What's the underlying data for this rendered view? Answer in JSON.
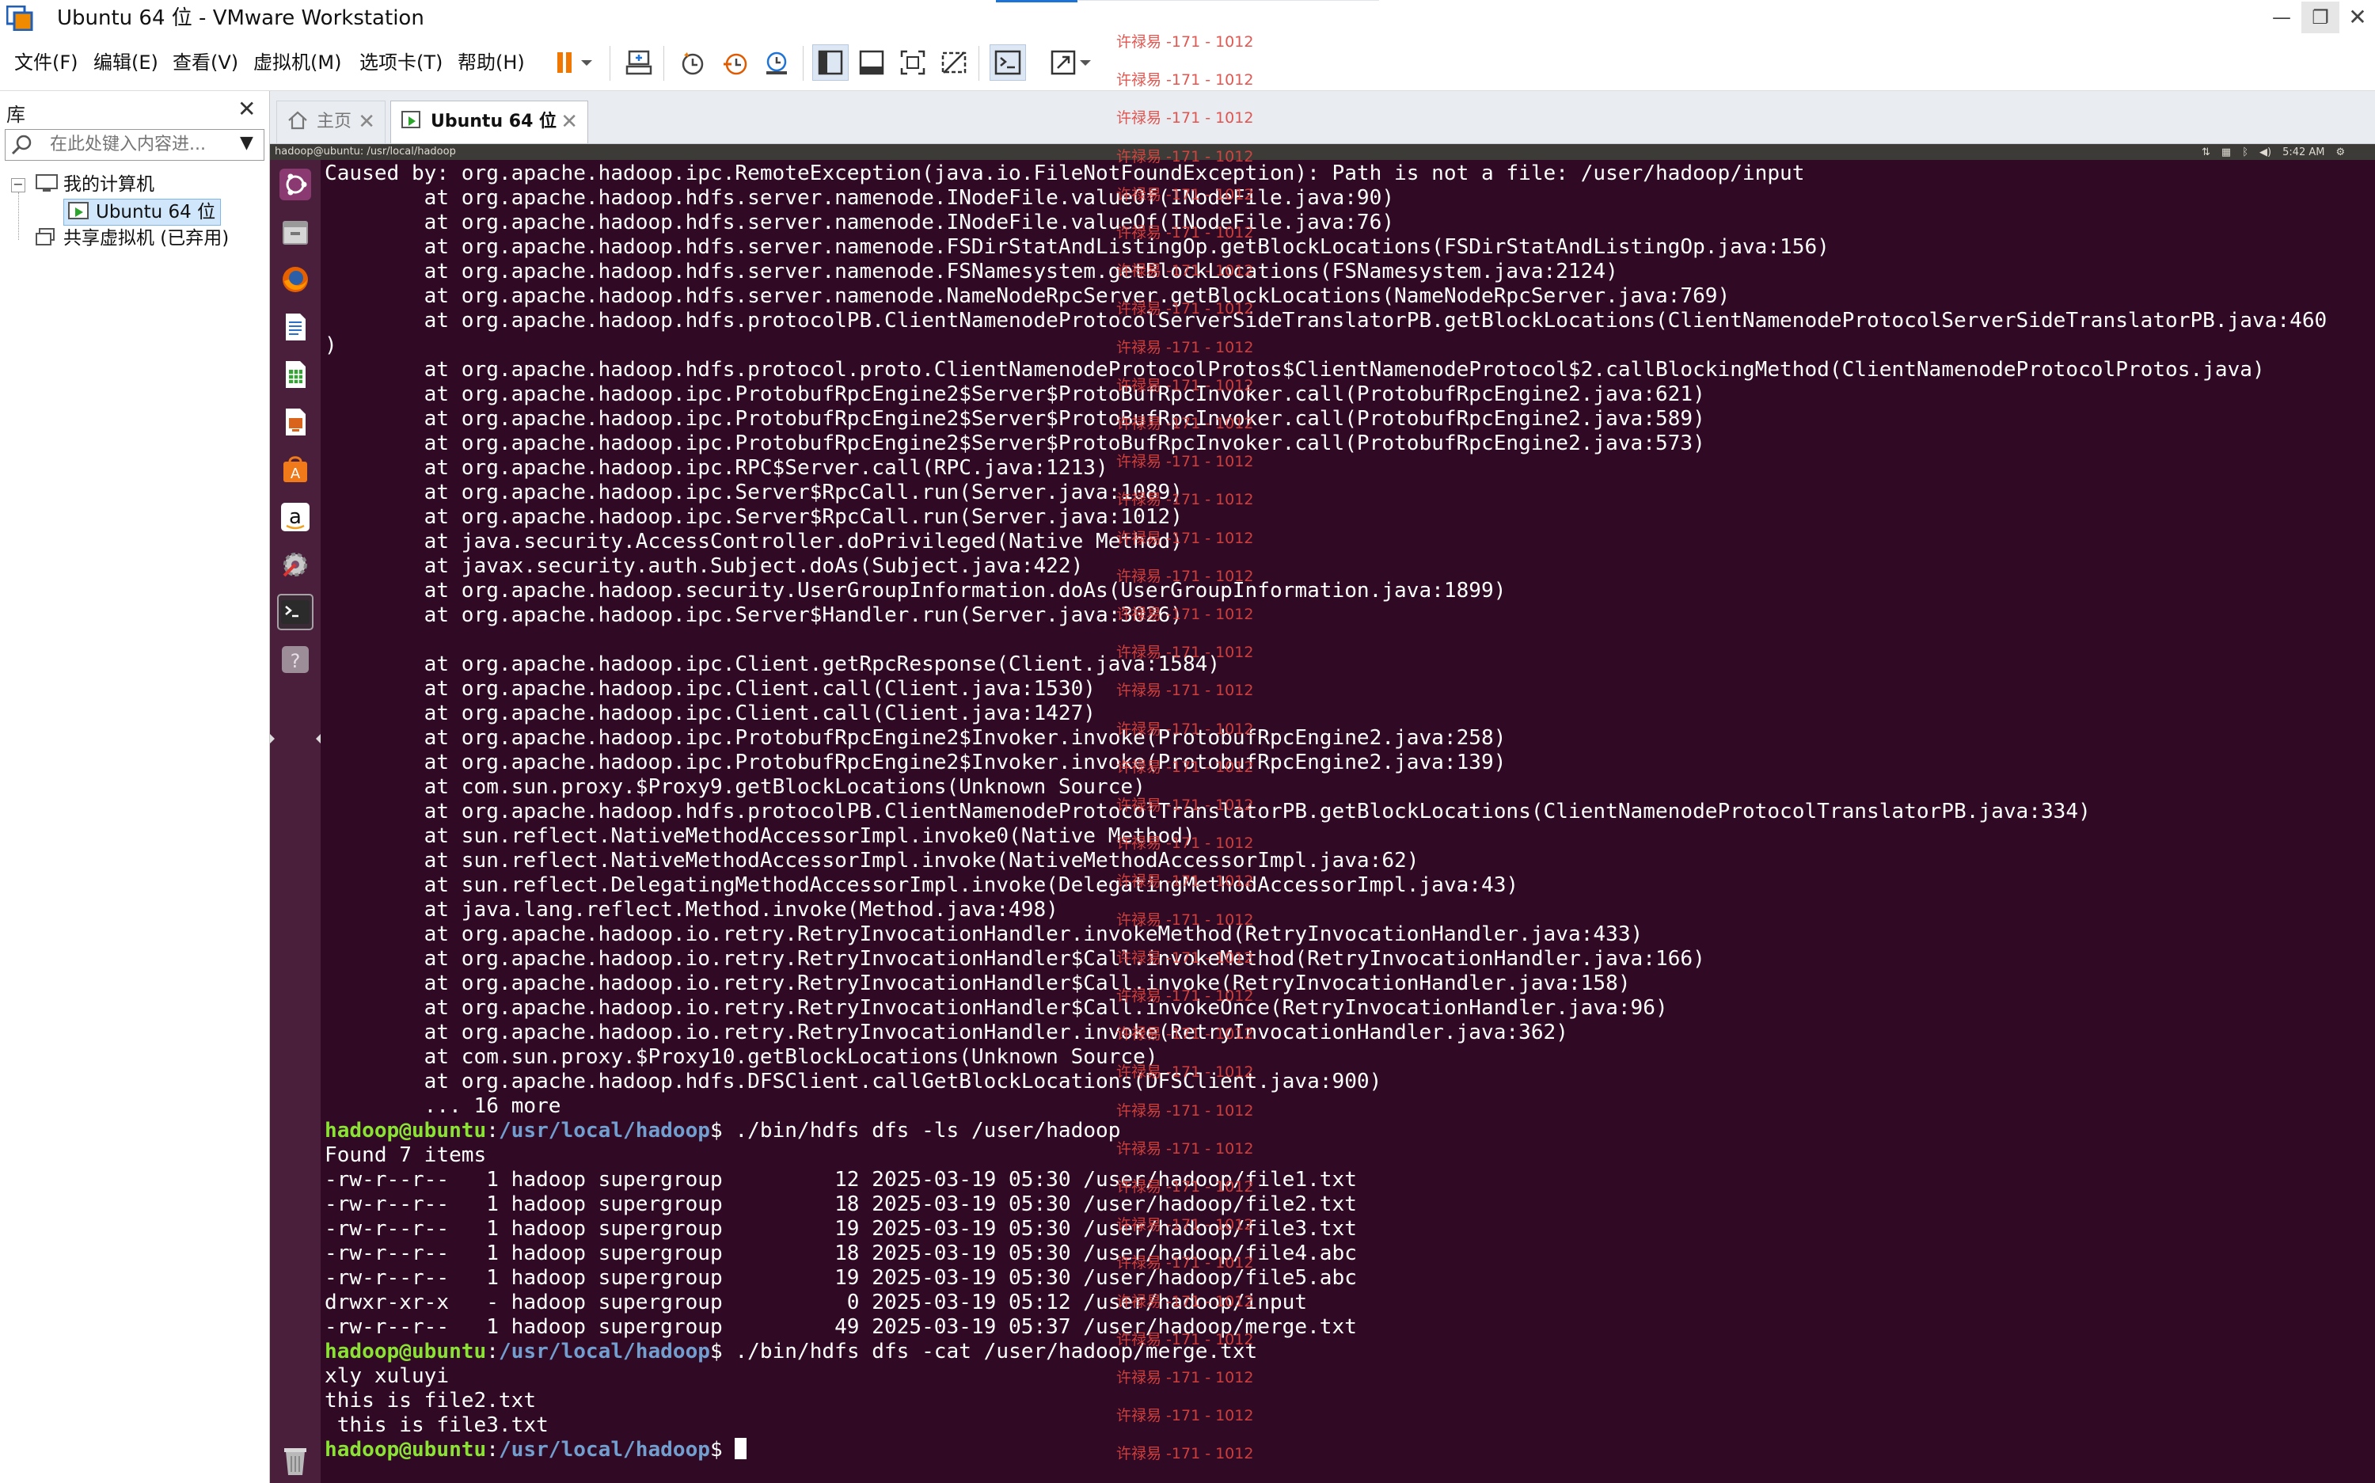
{
  "window": {
    "title": "Ubuntu 64 位 - VMware Workstation",
    "minimize": "—",
    "maximize": "❐",
    "close": "✕"
  },
  "menu": [
    "文件(F)",
    "编辑(E)",
    "查看(V)",
    "虚拟机(M)",
    "选项卡(T)",
    "帮助(H)"
  ],
  "library": {
    "title": "库",
    "close": "✕",
    "search_placeholder": "在此处键入内容进...",
    "tree": {
      "my_computer": "我的计算机",
      "ubuntu": "Ubuntu 64 位",
      "shared": "共享虚拟机 (已弃用)"
    }
  },
  "tabs": {
    "home": "主页",
    "ubuntu": "Ubuntu 64 位",
    "close": "✕"
  },
  "vm": {
    "panel_title": "hadoop@ubuntu: /usr/local/hadoop",
    "clock": "5:42 AM"
  },
  "terminal": {
    "block1": "Caused by: org.apache.hadoop.ipc.RemoteException(java.io.FileNotFoundException): Path is not a file: /user/hadoop/input\n\tat org.apache.hadoop.hdfs.server.namenode.INodeFile.valueOf(INodeFile.java:90)\n\tat org.apache.hadoop.hdfs.server.namenode.INodeFile.valueOf(INodeFile.java:76)\n\tat org.apache.hadoop.hdfs.server.namenode.FSDirStatAndListingOp.getBlockLocations(FSDirStatAndListingOp.java:156)\n\tat org.apache.hadoop.hdfs.server.namenode.FSNamesystem.getBlockLocations(FSNamesystem.java:2124)\n\tat org.apache.hadoop.hdfs.server.namenode.NameNodeRpcServer.getBlockLocations(NameNodeRpcServer.java:769)\n\tat org.apache.hadoop.hdfs.protocolPB.ClientNamenodeProtocolServerSideTranslatorPB.getBlockLocations(ClientNamenodeProtocolServerSideTranslatorPB.java:460\n)\n\tat org.apache.hadoop.hdfs.protocol.proto.ClientNamenodeProtocolProtos$ClientNamenodeProtocol$2.callBlockingMethod(ClientNamenodeProtocolProtos.java)\n\tat org.apache.hadoop.ipc.ProtobufRpcEngine2$Server$ProtoBufRpcInvoker.call(ProtobufRpcEngine2.java:621)\n\tat org.apache.hadoop.ipc.ProtobufRpcEngine2$Server$ProtoBufRpcInvoker.call(ProtobufRpcEngine2.java:589)\n\tat org.apache.hadoop.ipc.ProtobufRpcEngine2$Server$ProtoBufRpcInvoker.call(ProtobufRpcEngine2.java:573)\n\tat org.apache.hadoop.ipc.RPC$Server.call(RPC.java:1213)\n\tat org.apache.hadoop.ipc.Server$RpcCall.run(Server.java:1089)\n\tat org.apache.hadoop.ipc.Server$RpcCall.run(Server.java:1012)\n\tat java.security.AccessController.doPrivileged(Native Method)\n\tat javax.security.auth.Subject.doAs(Subject.java:422)\n\tat org.apache.hadoop.security.UserGroupInformation.doAs(UserGroupInformation.java:1899)\n\tat org.apache.hadoop.ipc.Server$Handler.run(Server.java:3026)\n\n\tat org.apache.hadoop.ipc.Client.getRpcResponse(Client.java:1584)\n\tat org.apache.hadoop.ipc.Client.call(Client.java:1530)\n\tat org.apache.hadoop.ipc.Client.call(Client.java:1427)\n\tat org.apache.hadoop.ipc.ProtobufRpcEngine2$Invoker.invoke(ProtobufRpcEngine2.java:258)\n\tat org.apache.hadoop.ipc.ProtobufRpcEngine2$Invoker.invoke(ProtobufRpcEngine2.java:139)\n\tat com.sun.proxy.$Proxy9.getBlockLocations(Unknown Source)\n\tat org.apache.hadoop.hdfs.protocolPB.ClientNamenodeProtocolTranslatorPB.getBlockLocations(ClientNamenodeProtocolTranslatorPB.java:334)\n\tat sun.reflect.NativeMethodAccessorImpl.invoke0(Native Method)\n\tat sun.reflect.NativeMethodAccessorImpl.invoke(NativeMethodAccessorImpl.java:62)\n\tat sun.reflect.DelegatingMethodAccessorImpl.invoke(DelegatingMethodAccessorImpl.java:43)\n\tat java.lang.reflect.Method.invoke(Method.java:498)\n\tat org.apache.hadoop.io.retry.RetryInvocationHandler.invokeMethod(RetryInvocationHandler.java:433)\n\tat org.apache.hadoop.io.retry.RetryInvocationHandler$Call.invokeMethod(RetryInvocationHandler.java:166)\n\tat org.apache.hadoop.io.retry.RetryInvocationHandler$Call.invoke(RetryInvocationHandler.java:158)\n\tat org.apache.hadoop.io.retry.RetryInvocationHandler$Call.invokeOnce(RetryInvocationHandler.java:96)\n\tat org.apache.hadoop.io.retry.RetryInvocationHandler.invoke(RetryInvocationHandler.java:362)\n\tat com.sun.proxy.$Proxy10.getBlockLocations(Unknown Source)\n\tat org.apache.hadoop.hdfs.DFSClient.callGetBlockLocations(DFSClient.java:900)\n\t... 16 more",
    "prompt_user": "hadoop@ubuntu",
    "prompt_sep": ":",
    "prompt_path": "/usr/local/hadoop",
    "prompt_end": "$ ",
    "cmd1": "./bin/hdfs dfs -ls /user/hadoop",
    "output1": "Found 7 items\n-rw-r--r--   1 hadoop supergroup         12 2025-03-19 05:30 /user/hadoop/file1.txt\n-rw-r--r--   1 hadoop supergroup         18 2025-03-19 05:30 /user/hadoop/file2.txt\n-rw-r--r--   1 hadoop supergroup         19 2025-03-19 05:30 /user/hadoop/file3.txt\n-rw-r--r--   1 hadoop supergroup         18 2025-03-19 05:30 /user/hadoop/file4.abc\n-rw-r--r--   1 hadoop supergroup         19 2025-03-19 05:30 /user/hadoop/file5.abc\ndrwxr-xr-x   - hadoop supergroup          0 2025-03-19 05:12 /user/hadoop/input\n-rw-r--r--   1 hadoop supergroup         49 2025-03-19 05:37 /user/hadoop/merge.txt",
    "cmd2": "./bin/hdfs dfs -cat /user/hadoop/merge.txt",
    "output2": "xly xuluyi\nthis is file2.txt\n this is file3.txt"
  },
  "watermark": "许禄易 -171 - 1012",
  "colors": {
    "terminal_bg": "#300a24",
    "prompt_user": "#8ae234",
    "prompt_path": "#729fcf",
    "watermark": "#e0453f",
    "launcher_bg": "#4a1f3b"
  }
}
